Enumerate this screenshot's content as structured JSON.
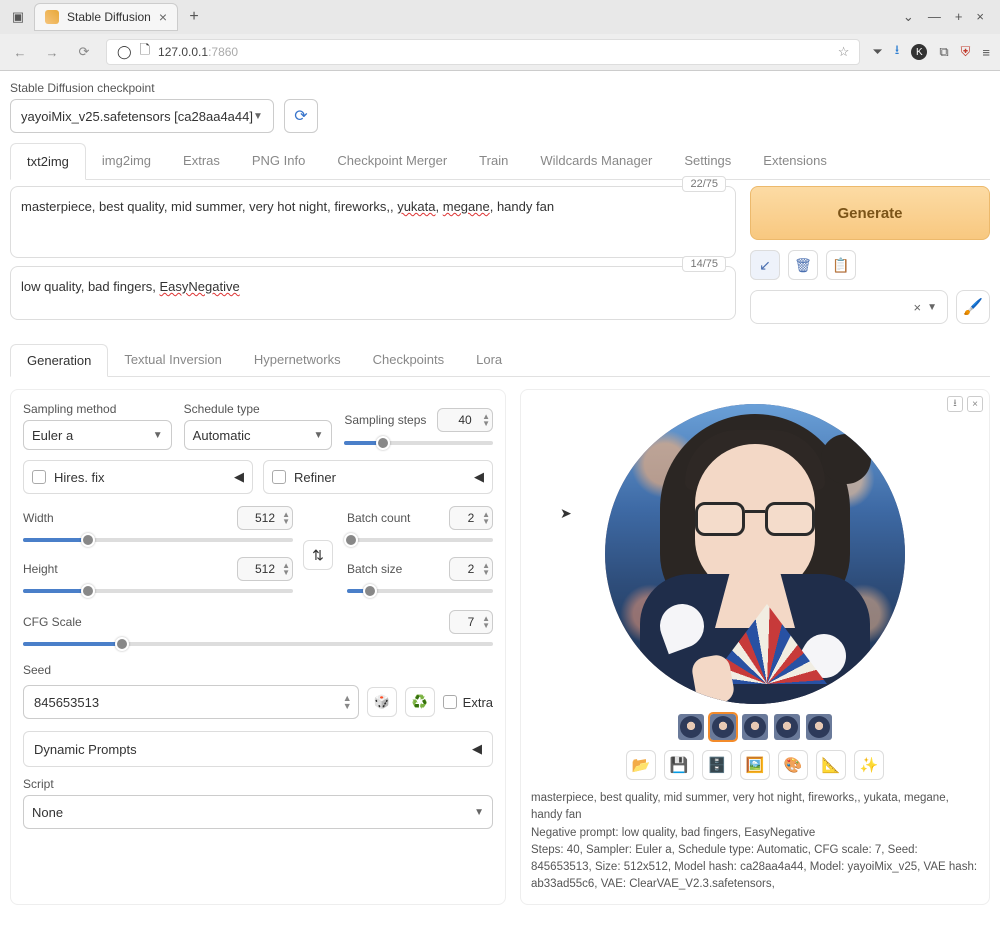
{
  "browser": {
    "tab_title": "Stable Diffusion",
    "url_host": "127.0.0.1",
    "url_port": ":7860"
  },
  "checkpoint": {
    "label": "Stable Diffusion checkpoint",
    "value": "yayoiMix_v25.safetensors [ca28aa4a44]"
  },
  "main_tabs": [
    "txt2img",
    "img2img",
    "Extras",
    "PNG Info",
    "Checkpoint Merger",
    "Train",
    "Wildcards Manager",
    "Settings",
    "Extensions"
  ],
  "prompts": {
    "positive_pre": "masterpiece, best quality,   mid summer, very hot  night, fireworks,, ",
    "positive_w1": "yukata",
    "positive_mid1": ", ",
    "positive_w2": "megane",
    "positive_post": ", handy fan",
    "positive_counter": "22/75",
    "negative_pre": "low quality, bad fingers, ",
    "negative_w1": "EasyNegative",
    "negative_counter": "14/75"
  },
  "generate_label": "Generate",
  "sub_tabs": [
    "Generation",
    "Textual Inversion",
    "Hypernetworks",
    "Checkpoints",
    "Lora"
  ],
  "sampler": {
    "method_label": "Sampling method",
    "method_value": "Euler a",
    "schedule_label": "Schedule type",
    "schedule_value": "Automatic",
    "steps_label": "Sampling steps",
    "steps_value": "40"
  },
  "hires": {
    "label": "Hires. fix"
  },
  "refiner": {
    "label": "Refiner"
  },
  "dims": {
    "width_label": "Width",
    "width_value": "512",
    "height_label": "Height",
    "height_value": "512",
    "batch_count_label": "Batch count",
    "batch_count_value": "2",
    "batch_size_label": "Batch size",
    "batch_size_value": "2"
  },
  "cfg": {
    "label": "CFG Scale",
    "value": "7"
  },
  "seed": {
    "label": "Seed",
    "value": "845653513",
    "extra_label": "Extra"
  },
  "dynamic_prompts": "Dynamic Prompts",
  "script": {
    "label": "Script",
    "value": "None"
  },
  "info": {
    "line1": "masterpiece, best quality, mid summer, very hot night, fireworks,, yukata, megane, handy fan",
    "line2": "Negative prompt: low quality, bad fingers, EasyNegative",
    "line3": "Steps: 40, Sampler: Euler a, Schedule type: Automatic, CFG scale: 7, Seed: 845653513, Size: 512x512, Model hash: ca28aa4a44, Model: yayoiMix_v25, VAE hash: ab33ad55c6, VAE: ClearVAE_V2.3.safetensors,"
  }
}
